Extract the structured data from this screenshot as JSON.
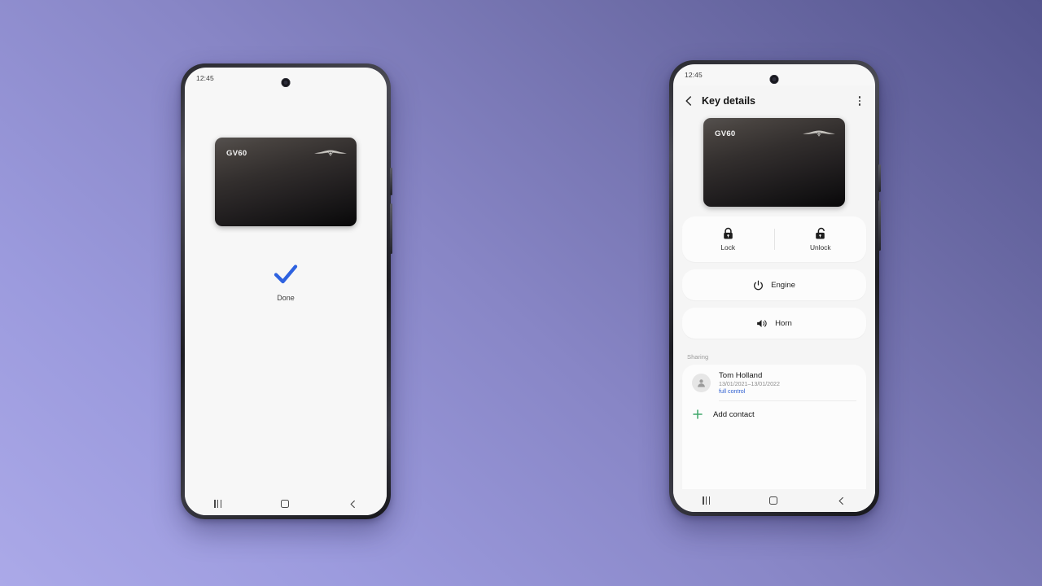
{
  "background": {
    "gradient_from": "#ABA9E8",
    "gradient_to": "#55558F"
  },
  "accents": {
    "check_blue": "#2E62E0",
    "link_blue": "#2F5FD0",
    "plus_green": "#3FA76A"
  },
  "left_phone": {
    "status_bar": {
      "time": "12:45"
    },
    "key_card": {
      "model": "GV60",
      "brand_emblem": "genesis-wings-emblem"
    },
    "result": {
      "icon": "check-icon",
      "label": "Done"
    },
    "nav_bar": {
      "recents": "recents-icon",
      "home": "home-icon",
      "back": "back-icon"
    }
  },
  "right_phone": {
    "status_bar": {
      "time": "12:45"
    },
    "app_bar": {
      "back": "back-chevron-icon",
      "title": "Key details",
      "menu": "overflow-menu-icon"
    },
    "key_card": {
      "model": "GV60",
      "brand_emblem": "genesis-wings-emblem"
    },
    "lock_controls": [
      {
        "icon": "lock-closed-icon",
        "label": "Lock"
      },
      {
        "icon": "lock-open-icon",
        "label": "Unlock"
      }
    ],
    "actions": [
      {
        "icon": "power-icon",
        "label": "Engine"
      },
      {
        "icon": "horn-speaker-icon",
        "label": "Horn"
      }
    ],
    "sharing": {
      "section_title": "Sharing",
      "contacts": [
        {
          "avatar": "person-avatar-icon",
          "name": "Tom Holland",
          "dates": "13/01/2021–13/01/2022",
          "permission": "full control"
        }
      ],
      "add_contact": {
        "icon": "plus-icon",
        "label": "Add contact"
      }
    },
    "nav_bar": {
      "recents": "recents-icon",
      "home": "home-icon",
      "back": "back-icon"
    }
  }
}
